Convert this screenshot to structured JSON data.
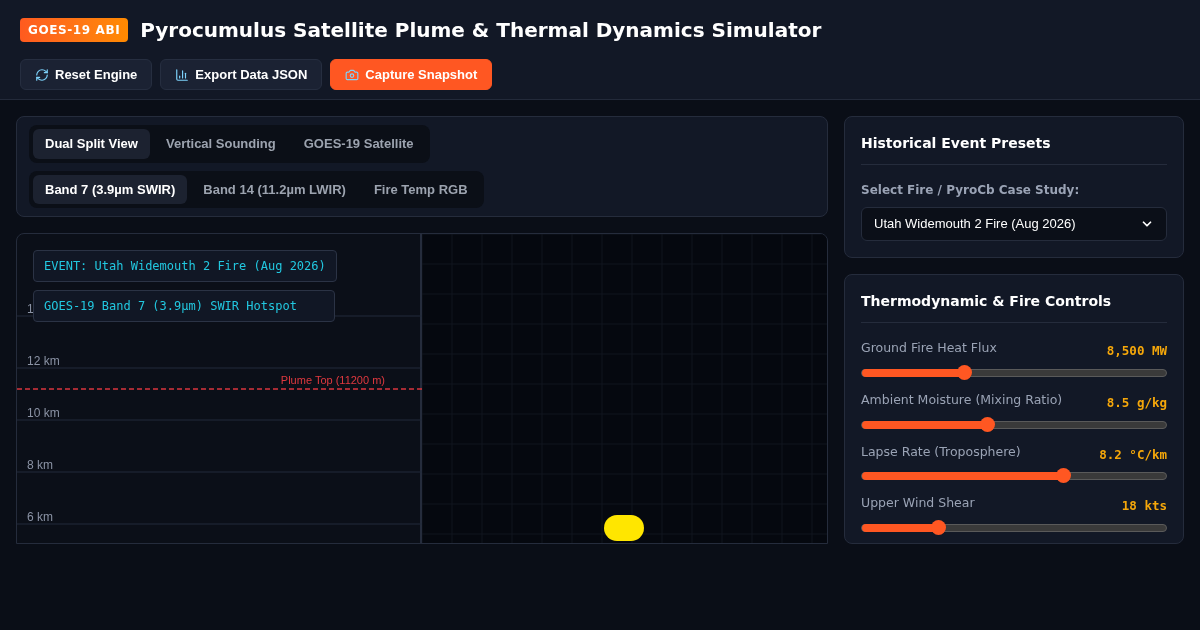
{
  "header": {
    "badge": "GOES-19 ABI",
    "title": "Pyrocumulus Satellite Plume & Thermal Dynamics Simulator"
  },
  "actions": [
    {
      "label": "Reset Engine",
      "kind": "reset",
      "primary": false
    },
    {
      "label": "Export Data JSON",
      "kind": "export",
      "primary": false
    },
    {
      "label": "Capture Snapshot",
      "kind": "capture",
      "primary": true
    }
  ],
  "view_tabs": [
    {
      "label": "Dual Split View",
      "selected": true
    },
    {
      "label": "Vertical Sounding",
      "selected": false
    },
    {
      "label": "GOES-19 Satellite",
      "selected": false
    }
  ],
  "band_tabs": [
    {
      "label": "Band 7 (3.9µm SWIR)",
      "selected": true
    },
    {
      "label": "Band 14 (11.2µm LWIR)",
      "selected": false
    },
    {
      "label": "Fire Temp RGB",
      "selected": false
    }
  ],
  "sounding": {
    "event_label": "EVENT: Utah Widemouth 2 Fire (Aug 2026)",
    "band_label": "GOES-19 Band 7 (3.9µm) SWIR Hotspot",
    "altitude_labels": [
      "1",
      "12 km",
      "10 km",
      "8 km",
      "6 km"
    ],
    "plume_top": "Plume Top (11200 m)"
  },
  "presets": {
    "title": "Historical Event Presets",
    "label": "Select Fire / PyroCb Case Study:",
    "value": "Utah Widemouth 2 Fire (Aug 2026)"
  },
  "controls": {
    "title": "Thermodynamic & Fire Controls",
    "sliders": [
      {
        "name": "Ground Fire Heat Flux",
        "reading": "8,500 MW",
        "level": 0.335
      },
      {
        "name": "Ambient Moisture (Mixing Ratio)",
        "reading": "8.5 g/kg",
        "level": 0.41
      },
      {
        "name": "Lapse Rate (Troposphere)",
        "reading": "8.2 °C/km",
        "level": 0.66
      },
      {
        "name": "Upper Wind Shear",
        "reading": "18 kts",
        "level": 0.25
      }
    ]
  }
}
